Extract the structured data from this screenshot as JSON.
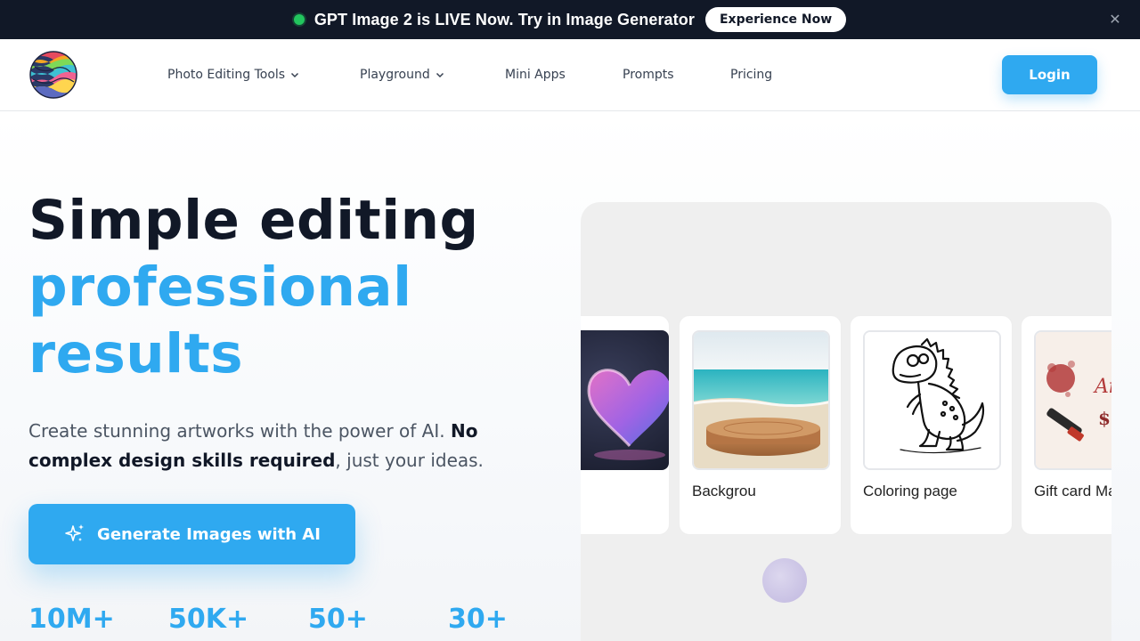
{
  "announcement": {
    "message": "GPT Image 2 is LIVE Now. Try in Image Generator",
    "cta": "Experience Now",
    "close_icon": "✕"
  },
  "header": {
    "logo_icon": "swirl-logo",
    "nav": [
      {
        "label": "Photo Editing Tools",
        "has_dropdown": true
      },
      {
        "label": "Playground",
        "has_dropdown": true
      },
      {
        "label": "Mini Apps",
        "has_dropdown": false
      },
      {
        "label": "Prompts",
        "has_dropdown": false
      },
      {
        "label": "Pricing",
        "has_dropdown": false
      }
    ],
    "login": "Login"
  },
  "hero": {
    "title_line1": "Simple editing",
    "title_line2": "professional",
    "title_line3": "results",
    "subtitle_part1": "Create stunning artworks with the power of AI. ",
    "subtitle_bold": "No complex design skills required",
    "subtitle_part2": ", just your ideas.",
    "cta": "Generate Images with AI",
    "stats": [
      "10M+",
      "50K+",
      "50+",
      "30+"
    ]
  },
  "showcase": {
    "cards": [
      {
        "label": "",
        "image": "glass-heart"
      },
      {
        "label": "Backgrou",
        "image": "beach-podium"
      },
      {
        "label": "Coloring page",
        "image": "dinosaur-line-art"
      },
      {
        "label": "Gift card Maker",
        "image": "gift-card"
      }
    ]
  },
  "colors": {
    "accent": "#2fa9f0",
    "dark": "#111827",
    "live_dot": "#22c55e"
  }
}
